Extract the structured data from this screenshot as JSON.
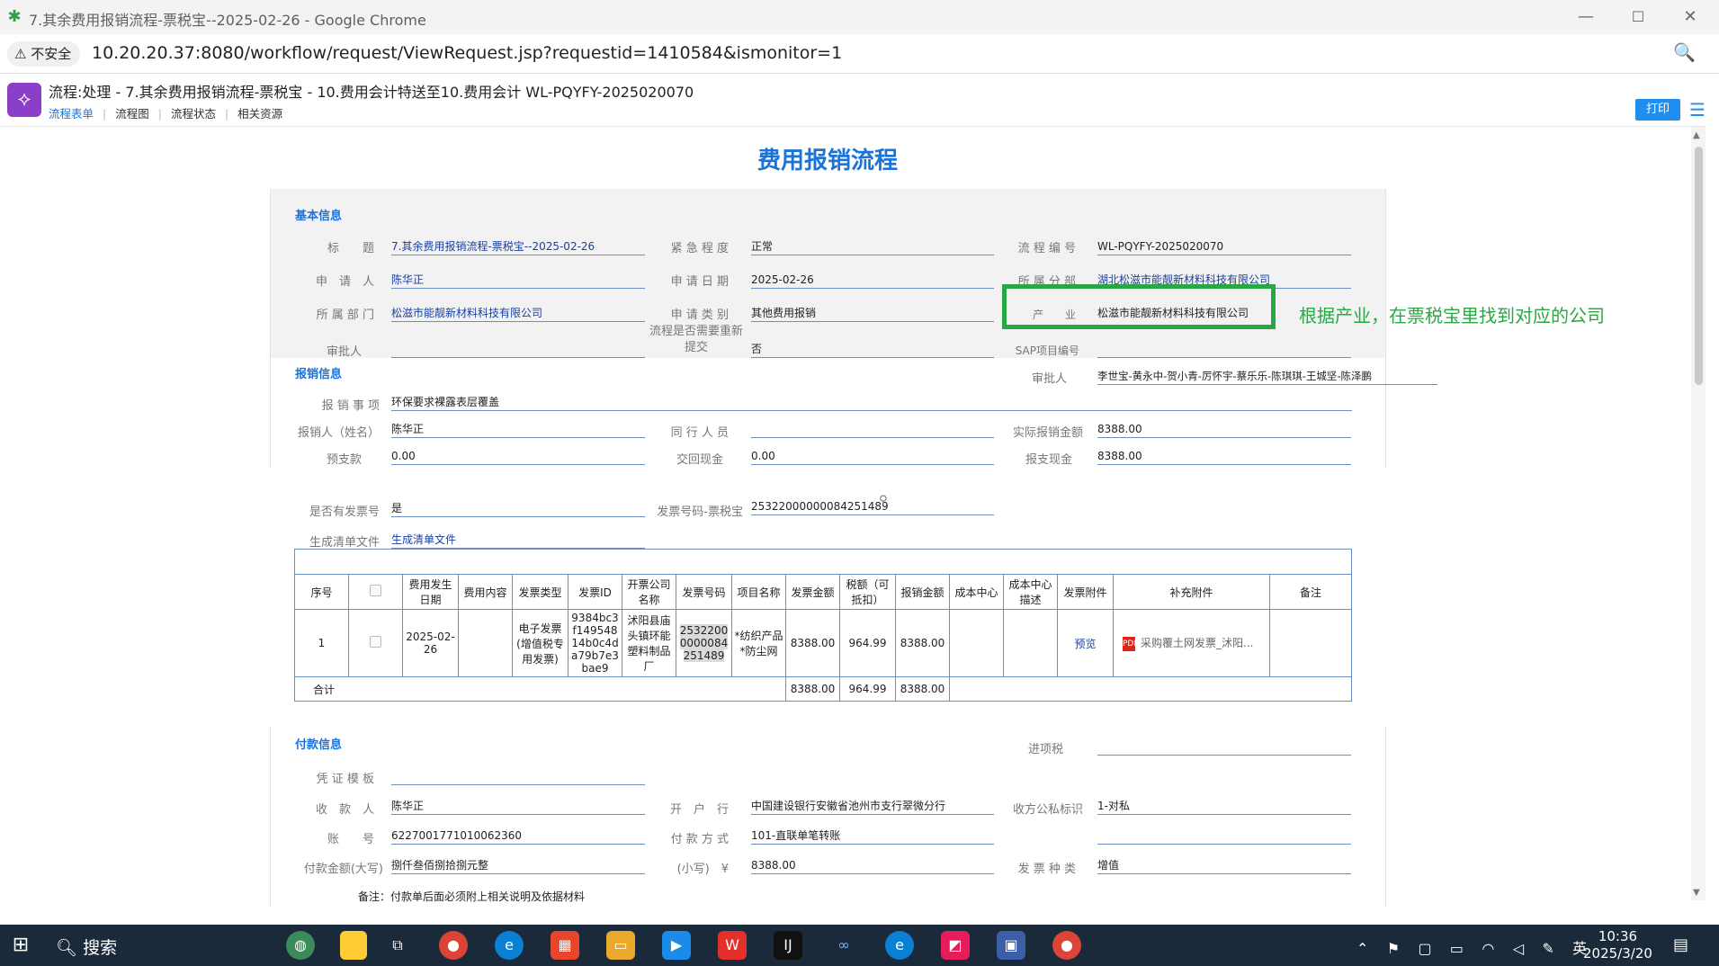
{
  "window": {
    "title": "7.其余费用报销流程-票税宝--2025-02-26 - Google Chrome",
    "minimize": "—",
    "maximize": "☐",
    "close": "✕"
  },
  "address": {
    "secure_label": "⚠ 不安全",
    "url": "10.20.20.37:8080/workflow/request/ViewRequest.jsp?requestid=1410584&ismonitor=1"
  },
  "workflow": {
    "title": "流程:处理 - 7.其余费用报销流程-票税宝 - 10.费用会计特送至10.费用会计 WL-PQYFY-2025020070",
    "tabs": [
      "流程表单",
      "流程图",
      "流程状态",
      "相关资源"
    ],
    "print_label": "打印"
  },
  "form": {
    "title": "费用报销流程",
    "basic": {
      "section_title": "基本信息",
      "title_label": "标　　题",
      "title_value": "7.其余费用报销流程-票税宝--2025-02-26",
      "urgency_label": "紧 急 程 度",
      "urgency_value": "正常",
      "flow_no_label": "流 程 编 号",
      "flow_no_value": "WL-PQYFY-2025020070",
      "applicant_label": "申　请　人",
      "applicant_value": "陈华正",
      "apply_date_label": "申 请 日 期",
      "apply_date_value": "2025-02-26",
      "branch_label": "所 属 分 部",
      "branch_value": "湖北松滋市能靓新材料科技有限公司",
      "dept_label": "所 属 部 门",
      "dept_value": "松滋市能靓新材料科技有限公司",
      "apply_type_label": "申 请 类 别",
      "apply_type_value": "其他费用报销",
      "industry_label": "产　　业",
      "industry_value": "松滋市能靓新材料科技有限公司",
      "approver_label": "审批人",
      "approver_value": "",
      "resubmit_label": "流程是否需要重新提交",
      "resubmit_value": "否",
      "sap_label": "SAP项目编号",
      "sap_value": ""
    },
    "expense": {
      "section_title": "报销信息",
      "approver2_label": "审批人",
      "approver2_value": "李世宝-黄永中-贺小青-厉怀宇-蔡乐乐-陈琪琪-王城坚-陈泽鹏",
      "item_label": "报 销 事 项",
      "item_value": "环保要求裸露表层覆盖",
      "person_label": "报销人（姓名）",
      "person_value": "陈华正",
      "companion_label": "同 行 人 员",
      "companion_value": "",
      "actual_label": "实际报销金额",
      "actual_value": "8388.00",
      "advance_label": "预支款",
      "advance_value": "0.00",
      "return_label": "交回现金",
      "return_value": "0.00",
      "pay_cash_label": "报支现金",
      "pay_cash_value": "8388.00",
      "has_invoice_label": "是否有发票号",
      "has_invoice_value": "是",
      "invoice_no_label": "发票号码-票税宝",
      "invoice_no_value": "25322000000084251489",
      "gen_list_label": "生成清单文件",
      "gen_list_value": "生成清单文件"
    },
    "table": {
      "headers": [
        "序号",
        "",
        "费用发生日期",
        "费用内容",
        "发票类型",
        "发票ID",
        "开票公司名称",
        "发票号码",
        "项目名称",
        "发票金额",
        "税额（可抵扣）",
        "报销金额",
        "成本中心",
        "成本中心描述",
        "发票附件",
        "补充附件",
        "备注"
      ],
      "row": {
        "seq": "1",
        "date": "2025-02-26",
        "content": "",
        "inv_type": "电子发票(增值税专用发票)",
        "inv_id": "9384bc3f14954814b0c4da79b7e3bae9",
        "company": "沭阳县庙头镇环能塑料制品厂",
        "inv_no": "25322000000084251489",
        "project": "*纺织产品*防尘网",
        "inv_amount": "8388.00",
        "tax": "964.99",
        "reimb": "8388.00",
        "cost_center": "",
        "cost_desc": "",
        "inv_attach": "预览",
        "extra_attach": "采购覆土网发票_沭阳...",
        "remark": ""
      },
      "total": {
        "label": "合计",
        "inv_amount": "8388.00",
        "tax": "964.99",
        "reimb": "8388.00"
      }
    },
    "payment": {
      "section_title": "付款信息",
      "input_tax_label": "进项税",
      "input_tax_value": "",
      "voucher_label": "凭 证 模 板",
      "voucher_value": "",
      "payee_label": "收　款　人",
      "payee_value": "陈华正",
      "bank_label": "开　户　行",
      "bank_value": "中国建设银行安徽省池州市支行翠微分行",
      "pub_priv_label": "收方公私标识",
      "pub_priv_value": "1-对私",
      "account_label": "账　　号",
      "account_value": "6227001771010062360",
      "pay_method_label": "付 款 方 式",
      "pay_method_value": "101-直联单笔转账",
      "pay_method_extra_value": "",
      "amount_cn_label": "付款金额(大写)",
      "amount_cn_value": "捌仟叁佰捌拾捌元整",
      "amount_small_label": "(小写)　¥",
      "amount_small_value": "8388.00",
      "inv_kind_label": "发 票 种 类",
      "inv_kind_value": "增值",
      "note": "备注：付款单后面必须附上相关说明及依据材料"
    }
  },
  "annotation": {
    "text": "根据产业，在票税宝里找到对应的公司",
    "color": "#2aa745"
  },
  "taskbar": {
    "search_label": "搜索",
    "ime": "英",
    "time": "10:36",
    "date": "2025/3/20"
  }
}
